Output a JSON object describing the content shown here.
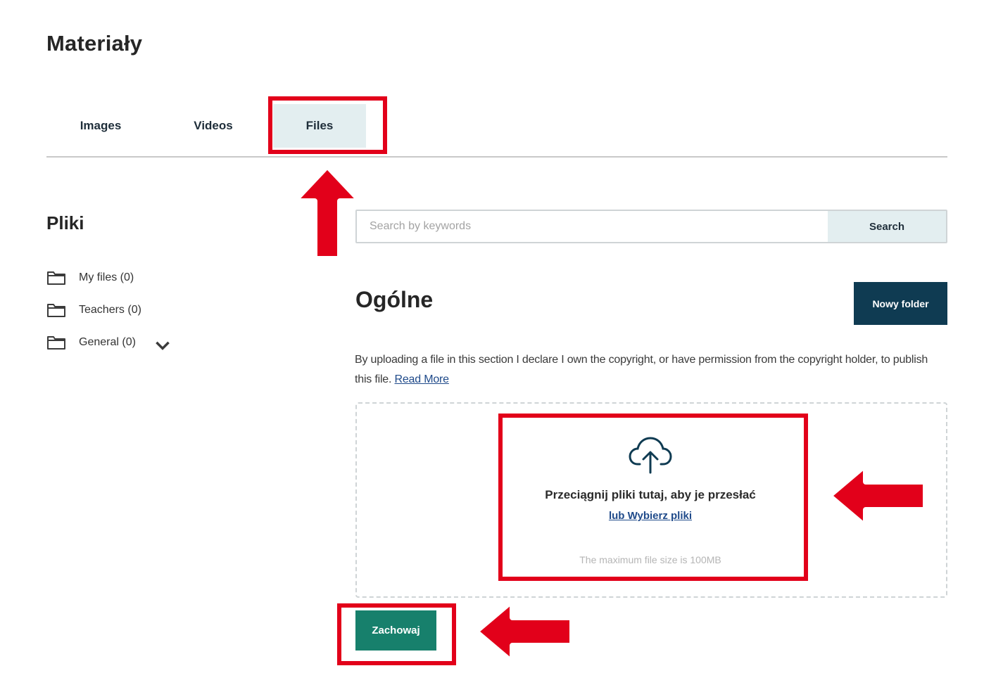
{
  "page": {
    "title": "Materiały"
  },
  "tabs": [
    {
      "label": "Images"
    },
    {
      "label": "Videos"
    },
    {
      "label": "Files"
    }
  ],
  "sidebar": {
    "title": "Pliki",
    "items": [
      {
        "label": "My files (0)",
        "icon": "folder-icon"
      },
      {
        "label": "Teachers (0)",
        "icon": "folder-icon"
      },
      {
        "label": "General (0)",
        "icon": "folder-icon"
      }
    ]
  },
  "search": {
    "placeholder": "Search by keywords",
    "button_label": "Search"
  },
  "section": {
    "title": "Ogólne",
    "new_folder_label": "Nowy folder"
  },
  "notice": {
    "text": "By uploading a file in this section I declare I own the copyright, or have permission from the copyright holder, to publish this file.",
    "link_label": "Read More"
  },
  "upload": {
    "icon": "cloud-upload-icon",
    "drop_text": "Przeciągnij pliki tutaj, aby je przesłać",
    "browse_link": "lub Wybierz pliki",
    "max_size": "The maximum file size is 100MB"
  },
  "actions": {
    "save_label": "Zachowaj"
  },
  "colors": {
    "accent_navy": "#0f3b52",
    "save_green": "#17806c",
    "tab_active_bg": "#e3eef0",
    "highlight_red": "#e2001a"
  }
}
